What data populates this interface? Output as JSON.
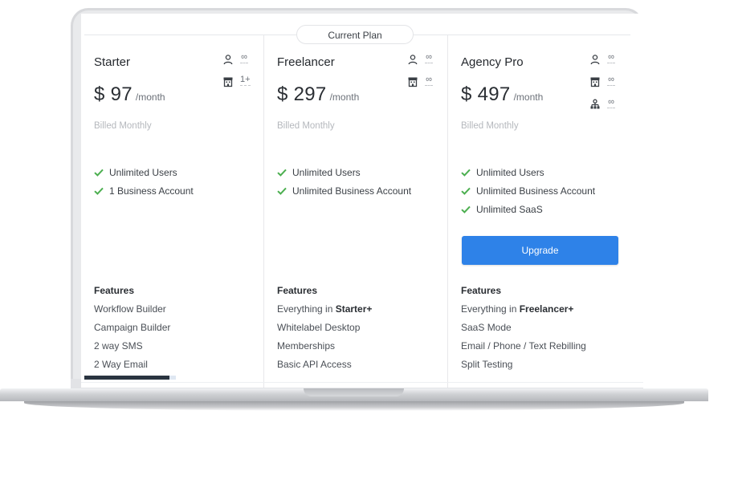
{
  "current_plan_label": "Current Plan",
  "plans": [
    {
      "name": "Starter",
      "price": "$ 97",
      "period": "/month",
      "billing": "Billed Monthly",
      "limits": [
        {
          "icon": "user-icon",
          "value": "∞"
        },
        {
          "icon": "building-icon",
          "value": "1+"
        }
      ],
      "checks": [
        "Unlimited Users",
        "1 Business Account"
      ],
      "features_title": "Features",
      "features": [
        {
          "text": "Workflow Builder"
        },
        {
          "text": "Campaign Builder"
        },
        {
          "text": "2 way SMS"
        },
        {
          "text": "2 Way Email"
        }
      ]
    },
    {
      "name": "Freelancer",
      "price": "$ 297",
      "period": "/month",
      "billing": "Billed Monthly",
      "limits": [
        {
          "icon": "user-icon",
          "value": "∞"
        },
        {
          "icon": "building-icon",
          "value": "∞"
        }
      ],
      "checks": [
        "Unlimited Users",
        "Unlimited Business Account"
      ],
      "features_title": "Features",
      "features": [
        {
          "prefix": "Everything in ",
          "bold": "Starter+"
        },
        {
          "text": "Whitelabel Desktop"
        },
        {
          "text": "Memberships"
        },
        {
          "text": "Basic API Access"
        }
      ]
    },
    {
      "name": "Agency Pro",
      "price": "$ 497",
      "period": "/month",
      "billing": "Billed Monthly",
      "limits": [
        {
          "icon": "user-icon",
          "value": "∞"
        },
        {
          "icon": "building-icon",
          "value": "∞"
        },
        {
          "icon": "network-icon",
          "value": "∞"
        }
      ],
      "checks": [
        "Unlimited Users",
        "Unlimited Business Account",
        "Unlimited SaaS"
      ],
      "upgrade_label": "Upgrade",
      "features_title": "Features",
      "features": [
        {
          "prefix": "Everything in ",
          "bold": "Freelancer+"
        },
        {
          "text": "SaaS Mode"
        },
        {
          "text": "Email / Phone / Text Rebilling"
        },
        {
          "text": "Split Testing"
        }
      ]
    }
  ],
  "colors": {
    "accent": "#2e82e8",
    "check": "#4caf50",
    "muted": "#b5b8bd"
  }
}
